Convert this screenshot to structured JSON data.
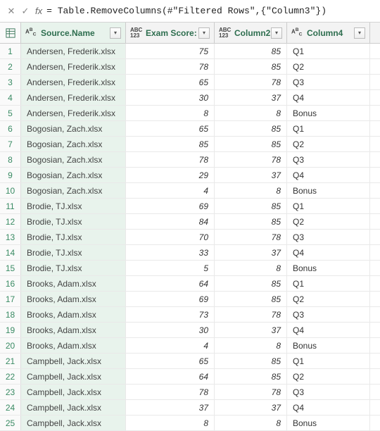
{
  "formula_bar": {
    "formula": "= Table.RemoveColumns(#\"Filtered Rows\",{\"Column3\"})"
  },
  "columns": {
    "source": {
      "label": "Source.Name",
      "type": "ABC"
    },
    "exam_score": {
      "label": "Exam Score:",
      "type": "ABC123"
    },
    "column2": {
      "label": "Column2",
      "type": "ABC123"
    },
    "column4": {
      "label": "Column4",
      "type": "ABC"
    }
  },
  "rows": [
    {
      "n": 1,
      "src": "Andersen, Frederik.xlsx",
      "score": "75",
      "col2": "85",
      "col4": "Q1"
    },
    {
      "n": 2,
      "src": "Andersen, Frederik.xlsx",
      "score": "78",
      "col2": "85",
      "col4": "Q2"
    },
    {
      "n": 3,
      "src": "Andersen, Frederik.xlsx",
      "score": "65",
      "col2": "78",
      "col4": "Q3"
    },
    {
      "n": 4,
      "src": "Andersen, Frederik.xlsx",
      "score": "30",
      "col2": "37",
      "col4": "Q4"
    },
    {
      "n": 5,
      "src": "Andersen, Frederik.xlsx",
      "score": "8",
      "col2": "8",
      "col4": "Bonus"
    },
    {
      "n": 6,
      "src": "Bogosian, Zach.xlsx",
      "score": "65",
      "col2": "85",
      "col4": "Q1"
    },
    {
      "n": 7,
      "src": "Bogosian, Zach.xlsx",
      "score": "85",
      "col2": "85",
      "col4": "Q2"
    },
    {
      "n": 8,
      "src": "Bogosian, Zach.xlsx",
      "score": "78",
      "col2": "78",
      "col4": "Q3"
    },
    {
      "n": 9,
      "src": "Bogosian, Zach.xlsx",
      "score": "29",
      "col2": "37",
      "col4": "Q4"
    },
    {
      "n": 10,
      "src": "Bogosian, Zach.xlsx",
      "score": "4",
      "col2": "8",
      "col4": "Bonus"
    },
    {
      "n": 11,
      "src": "Brodie, TJ.xlsx",
      "score": "69",
      "col2": "85",
      "col4": "Q1"
    },
    {
      "n": 12,
      "src": "Brodie, TJ.xlsx",
      "score": "84",
      "col2": "85",
      "col4": "Q2"
    },
    {
      "n": 13,
      "src": "Brodie, TJ.xlsx",
      "score": "70",
      "col2": "78",
      "col4": "Q3"
    },
    {
      "n": 14,
      "src": "Brodie, TJ.xlsx",
      "score": "33",
      "col2": "37",
      "col4": "Q4"
    },
    {
      "n": 15,
      "src": "Brodie, TJ.xlsx",
      "score": "5",
      "col2": "8",
      "col4": "Bonus"
    },
    {
      "n": 16,
      "src": "Brooks, Adam.xlsx",
      "score": "64",
      "col2": "85",
      "col4": "Q1"
    },
    {
      "n": 17,
      "src": "Brooks, Adam.xlsx",
      "score": "69",
      "col2": "85",
      "col4": "Q2"
    },
    {
      "n": 18,
      "src": "Brooks, Adam.xlsx",
      "score": "73",
      "col2": "78",
      "col4": "Q3"
    },
    {
      "n": 19,
      "src": "Brooks, Adam.xlsx",
      "score": "30",
      "col2": "37",
      "col4": "Q4"
    },
    {
      "n": 20,
      "src": "Brooks, Adam.xlsx",
      "score": "4",
      "col2": "8",
      "col4": "Bonus"
    },
    {
      "n": 21,
      "src": "Campbell, Jack.xlsx",
      "score": "65",
      "col2": "85",
      "col4": "Q1"
    },
    {
      "n": 22,
      "src": "Campbell, Jack.xlsx",
      "score": "64",
      "col2": "85",
      "col4": "Q2"
    },
    {
      "n": 23,
      "src": "Campbell, Jack.xlsx",
      "score": "78",
      "col2": "78",
      "col4": "Q3"
    },
    {
      "n": 24,
      "src": "Campbell, Jack.xlsx",
      "score": "37",
      "col2": "37",
      "col4": "Q4"
    },
    {
      "n": 25,
      "src": "Campbell, Jack.xlsx",
      "score": "8",
      "col2": "8",
      "col4": "Bonus"
    }
  ]
}
